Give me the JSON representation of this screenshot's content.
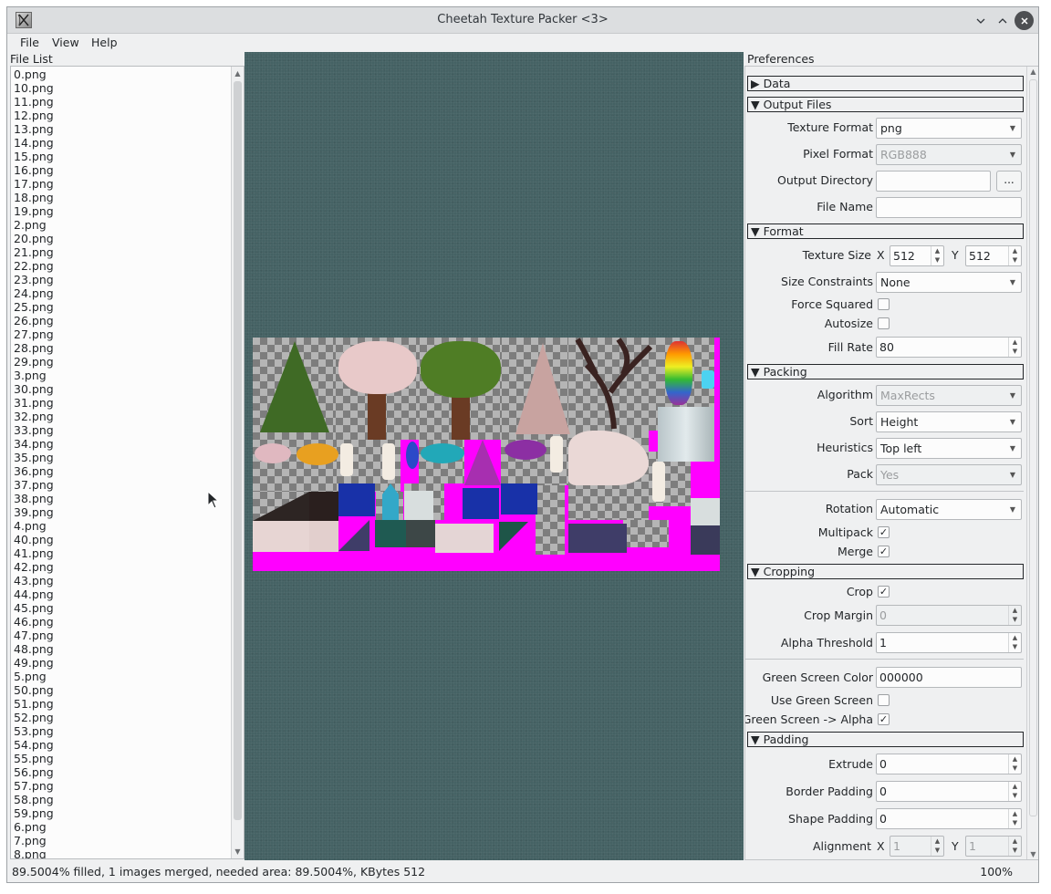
{
  "window": {
    "title": "Cheetah Texture Packer <3>",
    "buttons": {
      "minimize": "⌄",
      "maximize": "⌃",
      "close": "✕"
    }
  },
  "menu": {
    "file": "File",
    "view": "View",
    "help": "Help"
  },
  "file_list": {
    "label": "File List",
    "items": [
      "0.png",
      "10.png",
      "11.png",
      "12.png",
      "13.png",
      "14.png",
      "15.png",
      "16.png",
      "17.png",
      "18.png",
      "19.png",
      "2.png",
      "20.png",
      "21.png",
      "22.png",
      "23.png",
      "24.png",
      "25.png",
      "26.png",
      "27.png",
      "28.png",
      "29.png",
      "3.png",
      "30.png",
      "31.png",
      "32.png",
      "33.png",
      "34.png",
      "35.png",
      "36.png",
      "37.png",
      "38.png",
      "39.png",
      "4.png",
      "40.png",
      "41.png",
      "42.png",
      "43.png",
      "44.png",
      "45.png",
      "46.png",
      "47.png",
      "48.png",
      "49.png",
      "5.png",
      "50.png",
      "51.png",
      "52.png",
      "53.png",
      "54.png",
      "55.png",
      "56.png",
      "57.png",
      "58.png",
      "59.png",
      "6.png",
      "7.png",
      "8.png"
    ]
  },
  "preferences": {
    "label": "Preferences",
    "sections": {
      "data": "▶ Data",
      "output_files": "▼ Output Files",
      "format": "▼ Format",
      "packing": "▼ Packing",
      "cropping": "▼ Cropping",
      "padding": "▼ Padding"
    },
    "texture_format": {
      "label": "Texture Format",
      "value": "png"
    },
    "pixel_format": {
      "label": "Pixel Format",
      "value": "RGB888"
    },
    "output_directory": {
      "label": "Output Directory",
      "value": "",
      "browse": "..."
    },
    "file_name": {
      "label": "File Name",
      "value": ""
    },
    "texture_size": {
      "label": "Texture Size",
      "x_label": "X",
      "x": "512",
      "y_label": "Y",
      "y": "512"
    },
    "size_constraints": {
      "label": "Size Constraints",
      "value": "None"
    },
    "force_squared": {
      "label": "Force Squared",
      "checked": false
    },
    "autosize": {
      "label": "Autosize",
      "checked": false
    },
    "fill_rate": {
      "label": "Fill Rate",
      "value": "80"
    },
    "algorithm": {
      "label": "Algorithm",
      "value": "MaxRects"
    },
    "sort": {
      "label": "Sort",
      "value": "Height"
    },
    "heuristics": {
      "label": "Heuristics",
      "value": "Top left"
    },
    "pack": {
      "label": "Pack",
      "value": "Yes"
    },
    "rotation": {
      "label": "Rotation",
      "value": "Automatic"
    },
    "multipack": {
      "label": "Multipack",
      "checked": true
    },
    "merge": {
      "label": "Merge",
      "checked": true
    },
    "crop": {
      "label": "Crop",
      "checked": true
    },
    "crop_margin": {
      "label": "Crop Margin",
      "value": "0"
    },
    "alpha_threshold": {
      "label": "Alpha Threshold",
      "value": "1"
    },
    "green_screen_color": {
      "label": "Green Screen Color",
      "value": "000000"
    },
    "use_green_screen": {
      "label": "Use Green Screen",
      "checked": false
    },
    "green_screen_alpha": {
      "label": "Green Screen -> Alpha",
      "checked": true
    },
    "extrude": {
      "label": "Extrude",
      "value": "0"
    },
    "border_padding": {
      "label": "Border Padding",
      "value": "0"
    },
    "shape_padding": {
      "label": "Shape Padding",
      "value": "0"
    },
    "alignment": {
      "label": "Alignment",
      "x_label": "X",
      "x": "1",
      "y_label": "Y",
      "y": "1"
    }
  },
  "status": {
    "text": "89.5004% filled, 1 images merged, needed area: 89.5004%, KBytes 512",
    "zoom": "100%"
  },
  "colors": {
    "canvas": "#456264",
    "atlas_fill": "#ff00ff",
    "window_bg": "#eff0f1"
  }
}
